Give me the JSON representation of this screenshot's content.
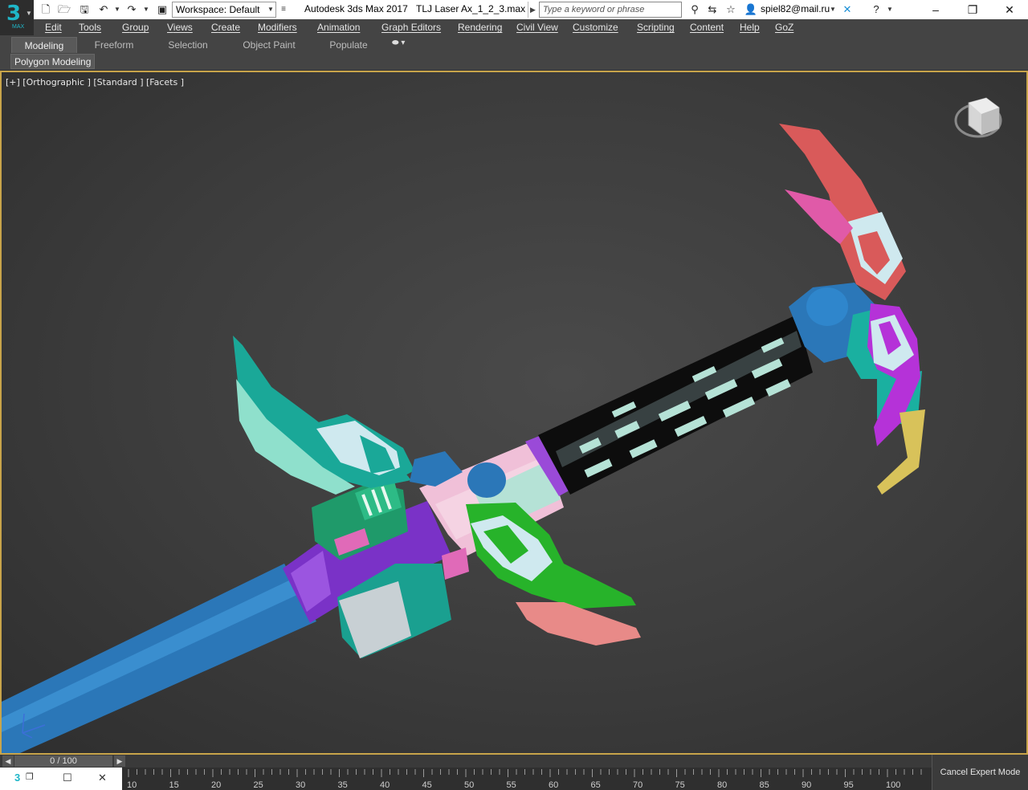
{
  "titlebar": {
    "workspace": "Workspace: Default",
    "app_title": "Autodesk 3ds Max 2017",
    "file_name": "TLJ Laser Ax_1_2_3.max",
    "search_placeholder": "Type a keyword or phrase",
    "user": "spiel82@mail.ru",
    "icons": [
      "new-file-icon",
      "open-file-icon",
      "save-icon",
      "undo-icon",
      "redo-icon",
      "project-icon",
      "binoculars-icon",
      "exchange-icon",
      "star-icon",
      "user-icon",
      "autodesk-x-icon",
      "help-icon"
    ]
  },
  "logo": {
    "glyph": "3",
    "sub": "MAX"
  },
  "menu": [
    {
      "u": "E",
      "rest": "dit"
    },
    {
      "u": "T",
      "rest": "ools"
    },
    {
      "u": "G",
      "rest": "roup"
    },
    {
      "u": "V",
      "rest": "iews"
    },
    {
      "u": "C",
      "rest": "reate"
    },
    {
      "u": "M",
      "rest": "odifiers"
    },
    {
      "u": "A",
      "rest": "nimation"
    },
    {
      "u": "G",
      "rest": "raph Editors"
    },
    {
      "u": "R",
      "rest": "endering"
    },
    {
      "u": "C",
      "rest": "ivil View"
    },
    {
      "u": "C",
      "rest": "ustomize"
    },
    {
      "u": "S",
      "rest": "cripting"
    },
    {
      "u": "C",
      "rest": "ontent"
    },
    {
      "u": "H",
      "rest": "elp"
    },
    {
      "u": "G",
      "rest": "oZ"
    }
  ],
  "ribbon": {
    "tabs": [
      "Modeling",
      "Freeform",
      "Selection",
      "Object Paint",
      "Populate"
    ],
    "active_tab": "Modeling",
    "panel_label": "Polygon Modeling"
  },
  "viewport": {
    "label": "[+] [Orthographic ] [Standard ] [Facets ]",
    "border_color": "#c8a44a"
  },
  "timeline": {
    "slider_text": "0 / 100",
    "ticks": [
      "10",
      "15",
      "20",
      "25",
      "30",
      "35",
      "40",
      "45",
      "50",
      "55",
      "60",
      "65",
      "70",
      "75",
      "80",
      "85",
      "90",
      "95",
      "100"
    ]
  },
  "expert_mode_button": "Cancel Expert Mode"
}
